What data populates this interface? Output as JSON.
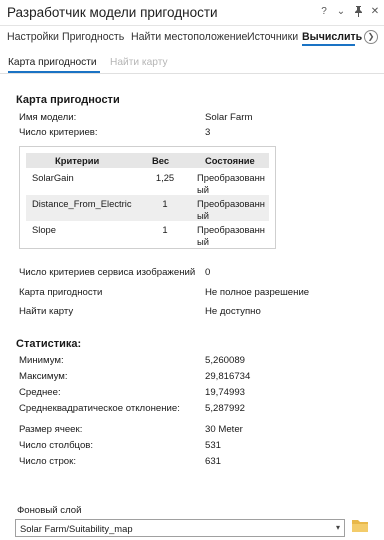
{
  "window": {
    "title": "Разработчик модели пригодности",
    "help_icon": "?",
    "menu_icon": "⌄",
    "pin_icon": "pin",
    "close_icon": "✕"
  },
  "tabs": [
    {
      "label": "Настройки"
    },
    {
      "label": "Пригодность"
    },
    {
      "label": "Найти местоположение"
    },
    {
      "label": "Источники"
    },
    {
      "label": "Вычислить"
    }
  ],
  "subtabs": {
    "active": "Карта пригодности",
    "disabled": "Найти карту"
  },
  "suitability": {
    "heading": "Карта пригодности",
    "model_name_label": "Имя модели:",
    "model_name_value": "Solar Farm",
    "criteria_count_label": "Число критериев:",
    "criteria_count_value": "3",
    "table": {
      "headers": [
        "Критерии",
        "Вес",
        "Состояние"
      ],
      "rows": [
        {
          "criterion": "SolarGain",
          "weight": "1,25",
          "state": "Преобразованный"
        },
        {
          "criterion": "Distance_From_Electric",
          "weight": "1",
          "state": "Преобразованный"
        },
        {
          "criterion": "Slope",
          "weight": "1",
          "state": "Преобразованный"
        }
      ]
    },
    "image_service_label": "Число критериев сервиса изображений",
    "image_service_value": "0",
    "map_label": "Карта пригодности",
    "map_value": "Не полное разрешение",
    "find_map_label": "Найти карту",
    "find_map_value": "Не доступно"
  },
  "statistics": {
    "heading": "Статистика:",
    "min_label": "Минимум:",
    "min_value": "5,260089",
    "max_label": "Максимум:",
    "max_value": "29,816734",
    "mean_label": "Среднее:",
    "mean_value": "19,74993",
    "std_label": "Среднеквадратическое отклонение:",
    "std_value": "5,287992",
    "cell_size_label": "Размер ячеек:",
    "cell_size_value": "30 Meter",
    "columns_label": "Число столбцов:",
    "columns_value": "531",
    "rows_label": "Число строк:",
    "rows_value": "631"
  },
  "background": {
    "label": "Фоновый слой",
    "value": "Solar Farm/Suitability_map"
  },
  "colors": {
    "accent": "#1a73c4",
    "folder": "#e8b84a"
  }
}
